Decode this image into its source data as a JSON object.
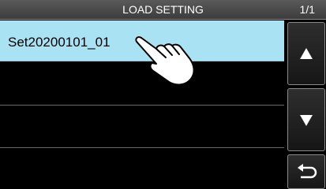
{
  "header": {
    "title": "LOAD SETTING",
    "page_indicator": "1/1"
  },
  "list": {
    "items": [
      {
        "label": "Set20200101_01",
        "selected": true
      },
      {
        "label": "",
        "selected": false
      },
      {
        "label": "",
        "selected": false
      },
      {
        "label": "",
        "selected": false
      }
    ]
  },
  "buttons": {
    "up_icon": "triangle-up-icon",
    "down_icon": "triangle-down-icon",
    "back_icon": "return-arrow-icon"
  },
  "colors": {
    "selected_row": "#a9e2f2",
    "background": "#000000",
    "text": "#ffffff"
  }
}
